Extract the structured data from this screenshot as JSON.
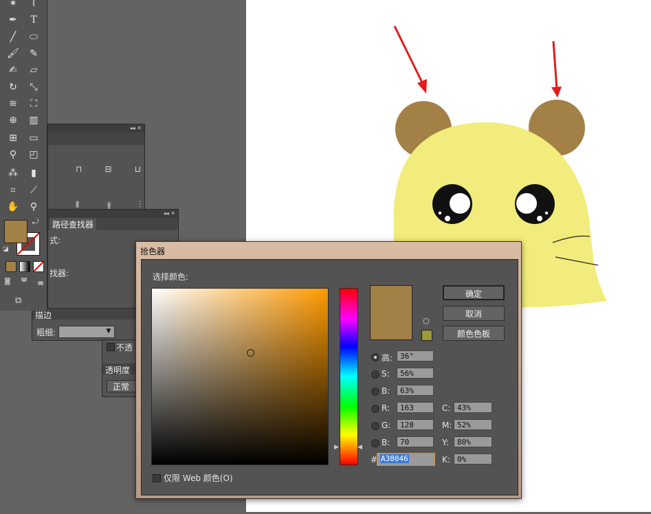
{
  "panels": {
    "pathfinder_label": "路径查找器",
    "shape_modes_fragment": "式:",
    "pathfinders_fragment": "找器:",
    "stroke_tab": "描边",
    "weight_label": "粗细:",
    "opacity_fragment": "不透",
    "transparency_tab": "透明度",
    "blend_mode": "正常"
  },
  "colors": {
    "current_fill": "#A38046",
    "ear": "#A38046",
    "body": "#F2EC7C",
    "arrow": "#E31B1B"
  },
  "dialog": {
    "title": "拾色器",
    "select_color_label": "选择颜色:",
    "ok": "确定",
    "cancel": "取消",
    "swatches": "颜色色板",
    "web_only": "仅限 Web 颜色(O)",
    "hsb": [
      {
        "key": "H",
        "label": "高:",
        "value": "36°",
        "selected": true
      },
      {
        "key": "S",
        "label": "S:",
        "value": "56%",
        "selected": false
      },
      {
        "key": "B",
        "label": "B:",
        "value": "63%",
        "selected": false
      }
    ],
    "rgb": [
      {
        "key": "R",
        "label": "R:",
        "value": "163"
      },
      {
        "key": "G",
        "label": "G:",
        "value": "128"
      },
      {
        "key": "B",
        "label": "B:",
        "value": "70"
      }
    ],
    "cmyk": [
      {
        "key": "C",
        "label": "C:",
        "value": "43%"
      },
      {
        "key": "M",
        "label": "M:",
        "value": "52%"
      },
      {
        "key": "Y",
        "label": "Y:",
        "value": "80%"
      },
      {
        "key": "K",
        "label": "K:",
        "value": "0%"
      }
    ],
    "hex_label": "#",
    "hex": "A38046",
    "hue_base": "#FF9A00",
    "gamut_warning_swatch": "#9E9A3C"
  },
  "icons": [
    "magic-wand-icon",
    "lasso-icon",
    "pen-icon",
    "type-icon",
    "line-icon",
    "ellipse-icon",
    "brush-icon",
    "pencil-icon",
    "eraser-icon",
    "rotate-icon",
    "scale-icon",
    "warp-icon",
    "free-transform-icon",
    "shape-builder-icon",
    "graph-icon",
    "mesh-icon",
    "gradient-icon",
    "eyedropper-icon",
    "blend-icon",
    "symbol-sprayer-icon",
    "column-graph-icon",
    "artboard-icon",
    "slice-icon",
    "hand-icon",
    "zoom-icon",
    "swap-icon",
    "screen-mode-icon"
  ]
}
